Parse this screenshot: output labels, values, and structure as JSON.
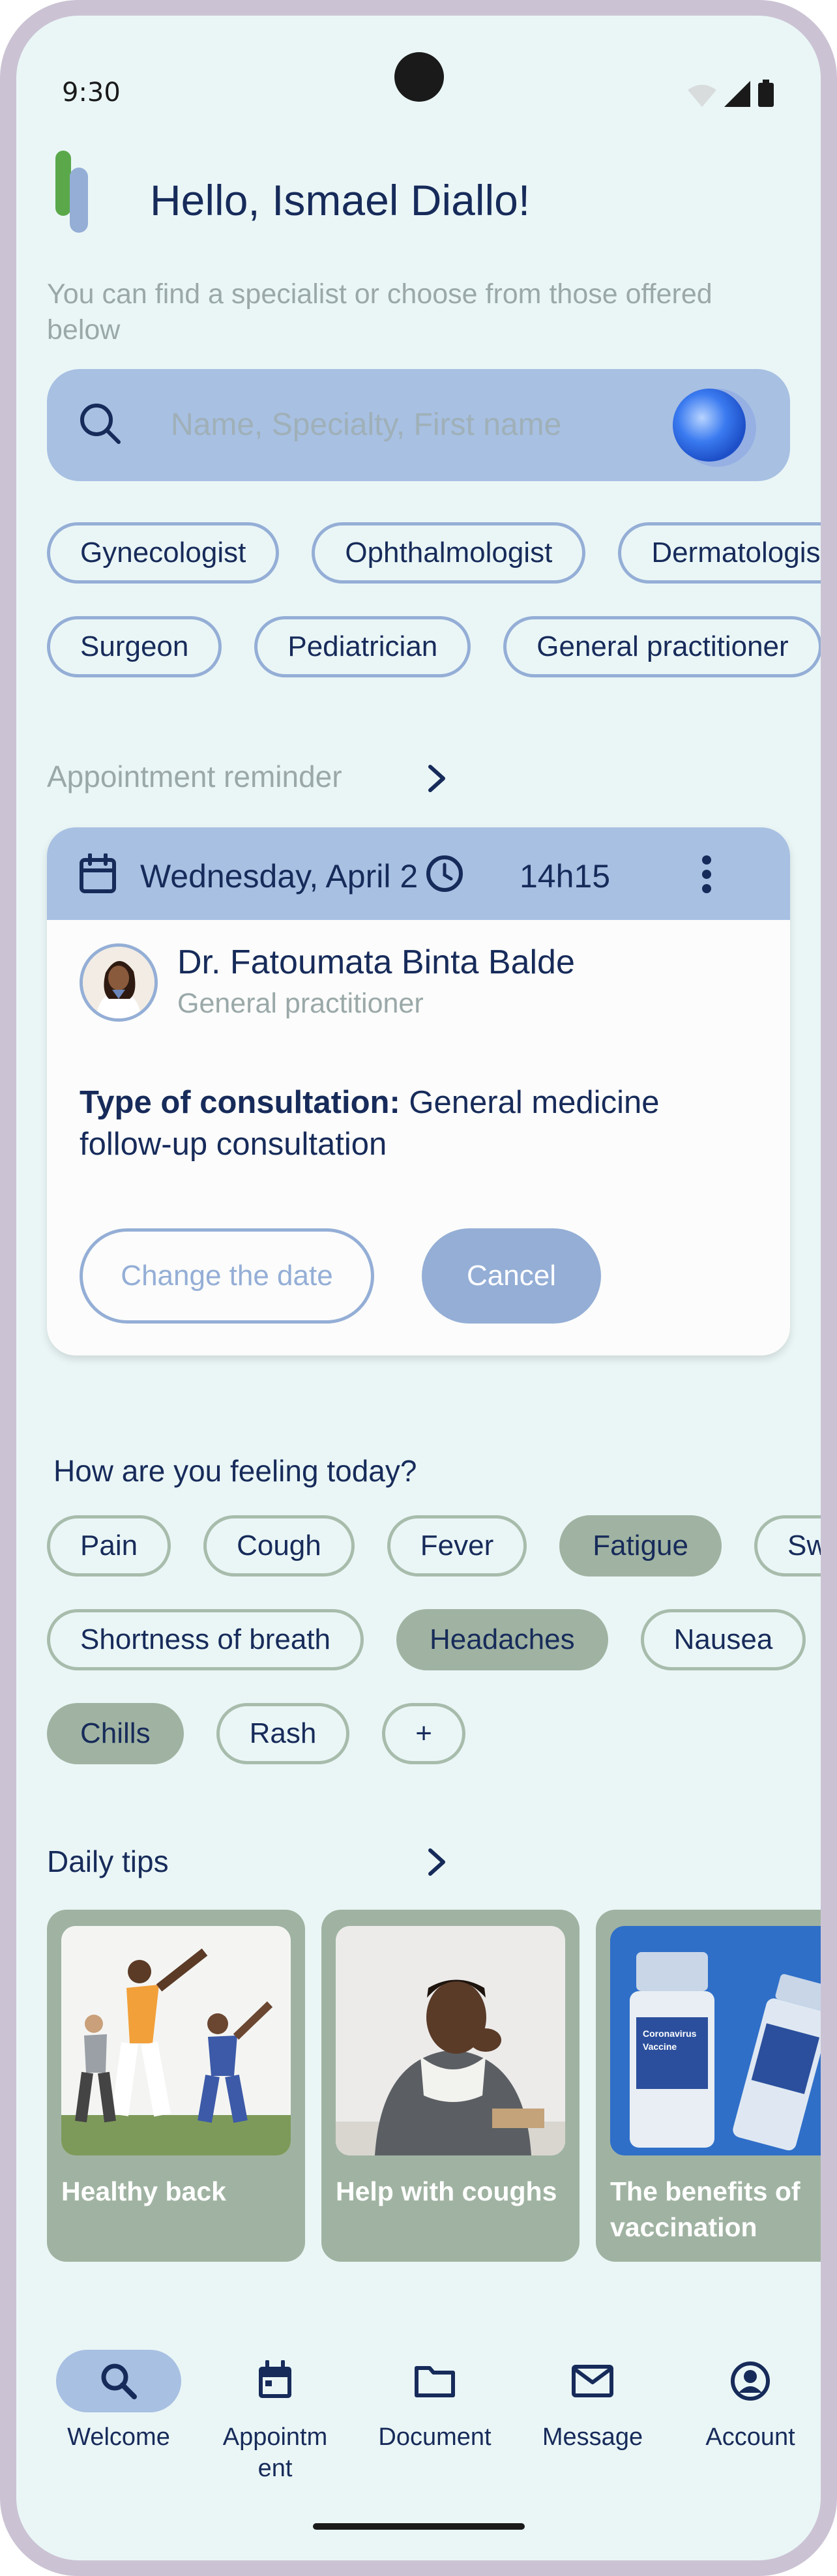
{
  "status_bar": {
    "time": "9:30"
  },
  "header": {
    "greeting": "Hello, Ismael Diallo!"
  },
  "intro_text": "You can find a specialist or choose from those offered below",
  "search": {
    "placeholder": "Name, Specialty, First name"
  },
  "specialties_row1": [
    "Gynecologist",
    "Ophthalmologist",
    "Dermatologist"
  ],
  "specialties_row2": [
    "Surgeon",
    "Pediatrician",
    "General practitioner"
  ],
  "appointment": {
    "section_title": "Appointment reminder",
    "date": "Wednesday, April 2",
    "time": "14h15",
    "doctor_name": "Dr. Fatoumata Binta Balde",
    "doctor_specialty": "General practitioner",
    "consultation_label": "Type of consultation:",
    "consultation_value": "General medicine follow-up consultation",
    "change_date_label": "Change the date",
    "cancel_label": "Cancel"
  },
  "feeling": {
    "title": "How are you feeling today?",
    "row1": [
      {
        "label": "Pain",
        "selected": false
      },
      {
        "label": "Cough",
        "selected": false
      },
      {
        "label": "Fever",
        "selected": false
      },
      {
        "label": "Fatigue",
        "selected": true
      },
      {
        "label": "Swe",
        "selected": false
      }
    ],
    "row2": [
      {
        "label": "Shortness of breath",
        "selected": false
      },
      {
        "label": "Headaches",
        "selected": true
      },
      {
        "label": "Nausea",
        "selected": false
      }
    ],
    "row3": [
      {
        "label": "Chills",
        "selected": true
      },
      {
        "label": "Rash",
        "selected": false
      },
      {
        "label": "+",
        "selected": false
      }
    ]
  },
  "tips": {
    "title": "Daily tips",
    "cards": [
      {
        "label": "Healthy back",
        "image": "people-stretching"
      },
      {
        "label": "Help with coughs",
        "image": "man-coughing"
      },
      {
        "label": "The benefits of vaccination",
        "image": "vaccine-vials"
      }
    ]
  },
  "nav": {
    "items": [
      {
        "label": "Welcome",
        "icon": "search-icon",
        "active": true
      },
      {
        "label": "Appointm ent",
        "icon": "calendar-icon",
        "active": false
      },
      {
        "label": "Document",
        "icon": "folder-icon",
        "active": false
      },
      {
        "label": "Message",
        "icon": "mail-icon",
        "active": false
      },
      {
        "label": "Account",
        "icon": "account-icon",
        "active": false
      }
    ]
  },
  "colors": {
    "background": "#eaf6f6",
    "primary_blue": "#a8c0e2",
    "chip_blue_border": "#94aed6",
    "sage_green": "#a0b3a2",
    "text_dark": "#172b5a",
    "text_muted": "#9aa8a8"
  }
}
